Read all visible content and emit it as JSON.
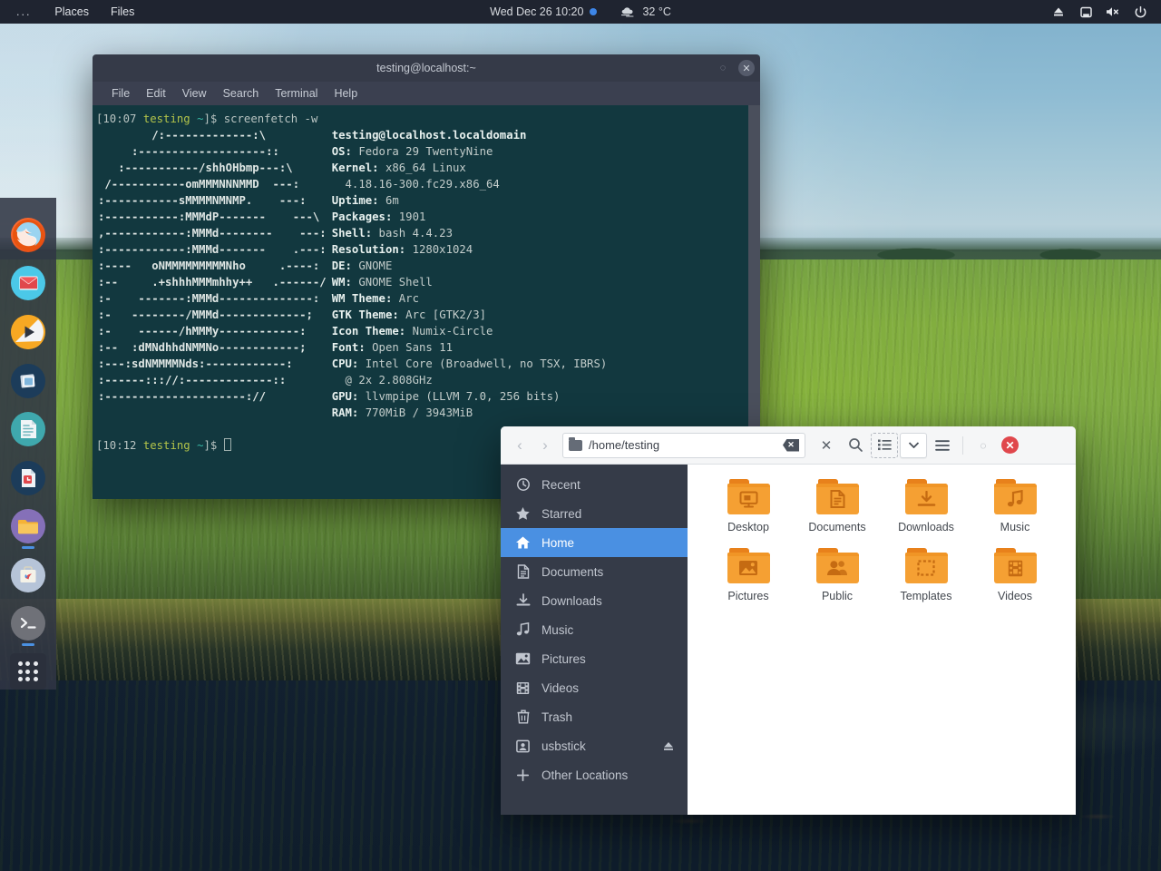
{
  "topbar": {
    "activities_label": "...",
    "menu_items": [
      "Places",
      "Files"
    ],
    "clock": "Wed Dec 26  10:20",
    "weather_temp": "32 °C",
    "tray_icons": [
      "eject-icon",
      "display-icon",
      "volume-muted-icon",
      "power-icon"
    ],
    "bg_color": "#1f2430"
  },
  "dock": {
    "items": [
      {
        "name": "firefox",
        "running": false
      },
      {
        "name": "mail",
        "running": false
      },
      {
        "name": "video-player",
        "running": false
      },
      {
        "name": "image-viewer",
        "running": false
      },
      {
        "name": "text-editor",
        "running": false
      },
      {
        "name": "office-document",
        "running": false
      },
      {
        "name": "files",
        "running": true
      },
      {
        "name": "software-store",
        "running": false
      },
      {
        "name": "terminal",
        "running": true
      }
    ],
    "show_applications_label": "Show Applications"
  },
  "terminal": {
    "title": "testing@localhost:~",
    "menu": [
      "File",
      "Edit",
      "View",
      "Search",
      "Terminal",
      "Help"
    ],
    "prompt_time_1": "10:07",
    "prompt_user": "testing",
    "prompt_dir": "~",
    "command": "screenfetch -w",
    "prompt_time_2": "10:12",
    "ascii_art": "        /:-------------:\\\n     :-------------------::\n   :-----------/shhOHbmp---:\\\n /-----------omMMMNNNMMD  ---:\n:-----------sMMMMNMNMP.    ---:\n:-----------:MMMdP-------    ---\\\n,------------:MMMd--------    ---:\n:------------:MMMd-------    .---:\n:----   oNMMMMMMMMMNho     .----:\n:--     .+shhhMMMmhhy++   .------/\n:-    -------:MMMd--------------:\n:-   --------/MMMd-------------;\n:-    ------/hMMMy------------:\n:--  :dMNdhhdNMMNo------------;\n:---:sdNMMMMNds:------------:\n:------::://:-------------::\n:---------------------://",
    "info": [
      {
        "key": "",
        "value": "testing@localhost.localdomain",
        "host": true
      },
      {
        "key": "OS:",
        "value": "Fedora 29 TwentyNine"
      },
      {
        "key": "Kernel:",
        "value": "x86_64 Linux"
      },
      {
        "key": "",
        "value": "  4.18.16-300.fc29.x86_64",
        "cont": true
      },
      {
        "key": "Uptime:",
        "value": "6m"
      },
      {
        "key": "Packages:",
        "value": "1901"
      },
      {
        "key": "Shell:",
        "value": "bash 4.4.23"
      },
      {
        "key": "Resolution:",
        "value": "1280x1024"
      },
      {
        "key": "DE:",
        "value": "GNOME"
      },
      {
        "key": "WM:",
        "value": "GNOME Shell"
      },
      {
        "key": "WM Theme:",
        "value": "Arc"
      },
      {
        "key": "GTK Theme:",
        "value": "Arc [GTK2/3]"
      },
      {
        "key": "Icon Theme:",
        "value": "Numix-Circle"
      },
      {
        "key": "Font:",
        "value": "Open Sans 11"
      },
      {
        "key": "CPU:",
        "value": "Intel Core (Broadwell, no TSX, IBRS)"
      },
      {
        "key": "",
        "value": "  @ 2x 2.808GHz",
        "cont": true
      },
      {
        "key": "GPU:",
        "value": "llvmpipe (LLVM 7.0, 256 bits)"
      },
      {
        "key": "RAM:",
        "value": "770MiB / 3943MiB"
      }
    ],
    "bg_color": "#12383f"
  },
  "nautilus": {
    "path_value": "/home/testing",
    "back_label": "Back",
    "forward_label": "Forward",
    "toolbar_icons": [
      "clear-icon",
      "stop-icon",
      "search-icon",
      "list-view-icon",
      "view-options-icon",
      "menu-icon",
      "maximize-icon",
      "close-icon"
    ],
    "sidebar": [
      {
        "label": "Recent",
        "icon": "clock-icon",
        "active": false
      },
      {
        "label": "Starred",
        "icon": "star-icon",
        "active": false
      },
      {
        "label": "Home",
        "icon": "home-icon",
        "active": true
      },
      {
        "label": "Documents",
        "icon": "document-icon",
        "active": false
      },
      {
        "label": "Downloads",
        "icon": "download-icon",
        "active": false
      },
      {
        "label": "Music",
        "icon": "music-icon",
        "active": false
      },
      {
        "label": "Pictures",
        "icon": "picture-icon",
        "active": false
      },
      {
        "label": "Videos",
        "icon": "video-icon",
        "active": false
      },
      {
        "label": "Trash",
        "icon": "trash-icon",
        "active": false
      },
      {
        "label": "usbstick",
        "icon": "usb-drive-icon",
        "active": false,
        "eject": true
      },
      {
        "label": "Other Locations",
        "icon": "plus-icon",
        "active": false
      }
    ],
    "files": [
      {
        "label": "Desktop",
        "glyph": "desktop-glyph"
      },
      {
        "label": "Documents",
        "glyph": "document-glyph"
      },
      {
        "label": "Downloads",
        "glyph": "download-glyph"
      },
      {
        "label": "Music",
        "glyph": "music-glyph"
      },
      {
        "label": "Pictures",
        "glyph": "picture-glyph"
      },
      {
        "label": "Public",
        "glyph": "people-glyph"
      },
      {
        "label": "Templates",
        "glyph": "template-glyph"
      },
      {
        "label": "Videos",
        "glyph": "film-glyph"
      }
    ],
    "accent_color": "#4a90e2",
    "sidebar_color": "#353b48",
    "folder_color": "#f5a033",
    "close_color": "#e0474c"
  }
}
